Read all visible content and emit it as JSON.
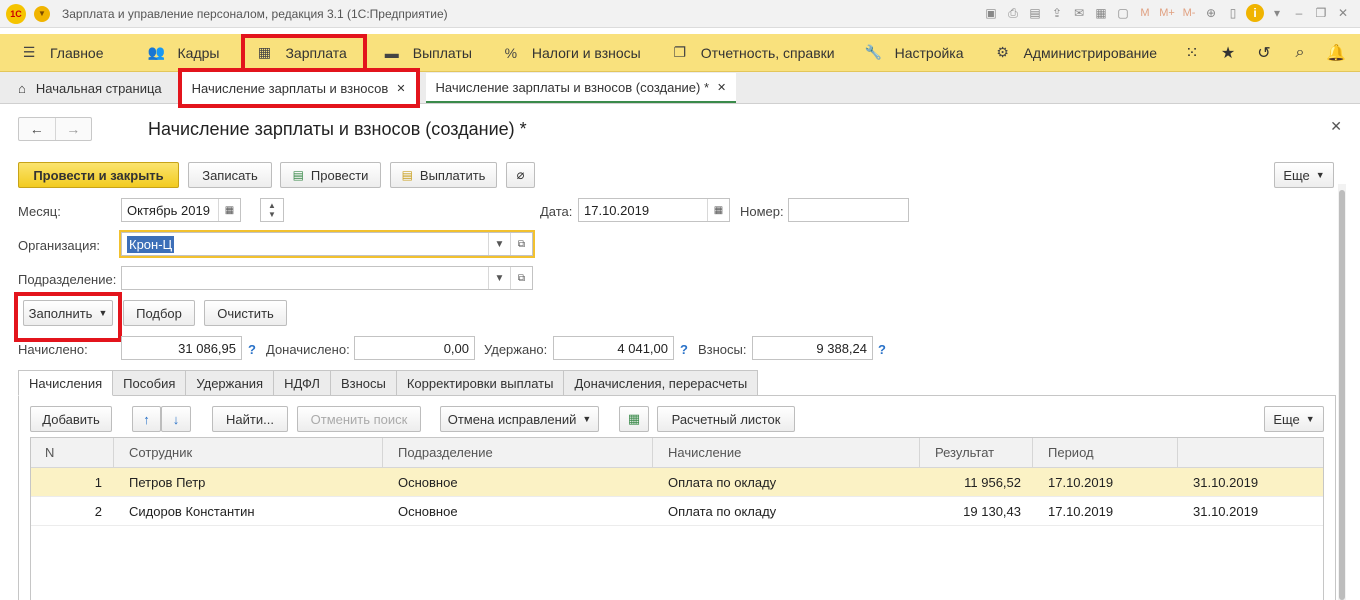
{
  "window": {
    "title": "Зарплата и управление персоналом, редакция 3.1  (1С:Предприятие)",
    "logo": "1С",
    "toolbar_marks": [
      "M",
      "M+",
      "M-"
    ]
  },
  "sections": [
    {
      "label": "Главное",
      "icon": "hamburger-icon"
    },
    {
      "label": "Кадры",
      "icon": "people-icon"
    },
    {
      "label": "Зарплата",
      "icon": "calculator-icon"
    },
    {
      "label": "Выплаты",
      "icon": "wallet-icon"
    },
    {
      "label": "Налоги и взносы",
      "icon": "percent-icon"
    },
    {
      "label": "Отчетность, справки",
      "icon": "reports-icon"
    },
    {
      "label": "Настройка",
      "icon": "wrench-icon"
    },
    {
      "label": "Администрирование",
      "icon": "gear-icon"
    }
  ],
  "tabs": {
    "home": "Начальная страница",
    "list": "Начисление зарплаты и взносов",
    "current": "Начисление зарплаты и взносов (создание) *"
  },
  "form": {
    "title": "Начисление зарплаты и взносов (создание) *",
    "toolbar": {
      "post_close": "Провести и закрыть",
      "save": "Записать",
      "post": "Провести",
      "pay": "Выплатить",
      "more": "Еще"
    },
    "month_label": "Месяц:",
    "month_value": "Октябрь 2019",
    "date_label": "Дата:",
    "date_value": "17.10.2019",
    "number_label": "Номер:",
    "number_value": "",
    "org_label": "Организация:",
    "org_value": "Крон-Ц",
    "dept_label": "Подразделение:",
    "dept_value": "",
    "fill": "Заполнить",
    "pick": "Подбор",
    "clear": "Очистить",
    "totals": {
      "accrued_label": "Начислено:",
      "accrued": "31 086,95",
      "added_label": "Доначислено:",
      "added": "0,00",
      "withheld_label": "Удержано:",
      "withheld": "4 041,00",
      "contrib_label": "Взносы:",
      "contrib": "9 388,24",
      "help": "?"
    }
  },
  "page_tabs": [
    "Начисления",
    "Пособия",
    "Удержания",
    "НДФЛ",
    "Взносы",
    "Корректировки выплаты",
    "Доначисления, перерасчеты"
  ],
  "grid_toolbar": {
    "add": "Добавить",
    "find": "Найти...",
    "cancel_search": "Отменить поиск",
    "cancel_fix": "Отмена исправлений",
    "payslip": "Расчетный листок",
    "more": "Еще"
  },
  "table": {
    "headers": [
      "N",
      "Сотрудник",
      "Подразделение",
      "Начисление",
      "Результат",
      "Период",
      ""
    ],
    "rows": [
      [
        "1",
        "Петров Петр",
        "Основное",
        "Оплата по окладу",
        "11 956,52",
        "17.10.2019",
        "31.10.2019"
      ],
      [
        "2",
        "Сидоров Константин",
        "Основное",
        "Оплата по окладу",
        "19 130,43",
        "17.10.2019",
        "31.10.2019"
      ]
    ]
  },
  "colors": {
    "section_bg": "#f9e17d",
    "highlight_red": "#e3141c",
    "primary_button": "#f2cb20",
    "selected_row": "#fbf2c5"
  }
}
